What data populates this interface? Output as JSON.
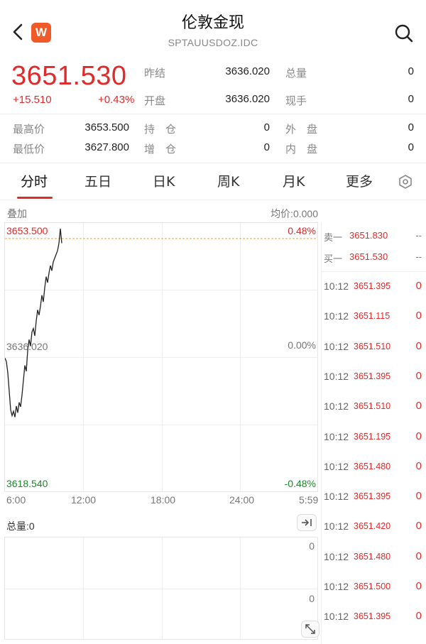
{
  "header": {
    "title": "伦敦金现",
    "subtitle": "SPTAUUSDOZ.IDC",
    "logo_letter": "W",
    "icons": [
      "back-icon",
      "search-icon"
    ]
  },
  "quote": {
    "price": "3651.530",
    "change": "+15.510",
    "change_pct": "+0.43%",
    "rows": [
      {
        "label": "昨结",
        "value": "3636.020",
        "label2": "总量",
        "value2": "0"
      },
      {
        "label": "开盘",
        "value": "3636.020",
        "label2": "现手",
        "value2": "0"
      }
    ],
    "stats": [
      {
        "label": "最高价",
        "value": "3653.500",
        "label2": "持　仓",
        "value2": "0",
        "label3": "外　盘",
        "value3": "0"
      },
      {
        "label": "最低价",
        "value": "3627.800",
        "label2": "增　仓",
        "value2": "0",
        "label3": "内　盘",
        "value3": "0"
      }
    ]
  },
  "tabs": [
    "分时",
    "五日",
    "日K",
    "周K",
    "月K",
    "更多"
  ],
  "active_tab": "分时",
  "chart": {
    "overlay_label": "叠加",
    "avg_label": "均价:0.000",
    "top_price": "3653.500",
    "top_pct": "0.48%",
    "mid_price": "3636.020",
    "mid_pct": "0.00%",
    "bottom_price": "3618.540",
    "bottom_pct": "-0.48%",
    "x_labels": [
      "6:00",
      "12:00",
      "18:00",
      "24:00",
      "5:59"
    ],
    "volume_label": "总量:0",
    "vol_top": "0",
    "vol_mid": "0"
  },
  "chart_data": {
    "type": "line",
    "ylim": [
      3618.54,
      3653.5
    ],
    "reference": 3636.02,
    "x": [
      0,
      1,
      2,
      3,
      4,
      5,
      6,
      7,
      8,
      9,
      10,
      11,
      12,
      13,
      14,
      15,
      16,
      17,
      18,
      19,
      20,
      21,
      22,
      23,
      24,
      25,
      26,
      27,
      28,
      29,
      30,
      31,
      32,
      33,
      34,
      35,
      36,
      37,
      38,
      39,
      40
    ],
    "values": [
      3636.0,
      3635.5,
      3634.0,
      3631.5,
      3629.0,
      3628.2,
      3628.8,
      3628.0,
      3629.5,
      3628.6,
      3630.0,
      3629.4,
      3631.0,
      3633.0,
      3635.0,
      3634.2,
      3637.0,
      3638.5,
      3637.6,
      3639.5,
      3640.0,
      3639.0,
      3641.0,
      3642.5,
      3641.8,
      3643.0,
      3644.5,
      3643.6,
      3645.5,
      3647.0,
      3646.2,
      3647.5,
      3648.5,
      3647.8,
      3649.0,
      3649.5,
      3650.0,
      3650.5,
      3651.5,
      3653.5,
      3651.53
    ]
  },
  "orderbook": [
    {
      "label": "卖一",
      "price": "3651.830",
      "vol": "--"
    },
    {
      "label": "买一",
      "price": "3651.530",
      "vol": "--"
    }
  ],
  "ticks": [
    {
      "time": "10:12",
      "price": "3651.395",
      "vol": "0"
    },
    {
      "time": "10:12",
      "price": "3651.115",
      "vol": "0"
    },
    {
      "time": "10:12",
      "price": "3651.510",
      "vol": "0"
    },
    {
      "time": "10:12",
      "price": "3651.395",
      "vol": "0"
    },
    {
      "time": "10:12",
      "price": "3651.510",
      "vol": "0"
    },
    {
      "time": "10:12",
      "price": "3651.195",
      "vol": "0"
    },
    {
      "time": "10:12",
      "price": "3651.480",
      "vol": "0"
    },
    {
      "time": "10:12",
      "price": "3651.395",
      "vol": "0"
    },
    {
      "time": "10:12",
      "price": "3651.420",
      "vol": "0"
    },
    {
      "time": "10:12",
      "price": "3651.480",
      "vol": "0"
    },
    {
      "time": "10:12",
      "price": "3651.500",
      "vol": "0"
    },
    {
      "time": "10:12",
      "price": "3651.395",
      "vol": "0"
    }
  ],
  "colors": {
    "up": "#e02a2a",
    "down": "#1a8a2a",
    "ref_line": "#f0a030"
  }
}
